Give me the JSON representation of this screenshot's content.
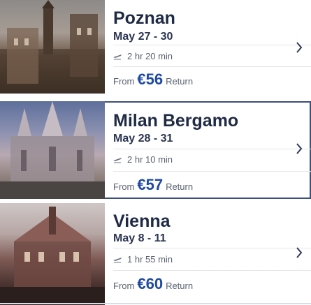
{
  "destinations": [
    {
      "city": "Poznan",
      "dates": "May 27 - 30",
      "duration": "2 hr 20 min",
      "from_label": "From",
      "price": "€56",
      "price_suffix": "Return"
    },
    {
      "city": "Milan Bergamo",
      "dates": "May 28 - 31",
      "duration": "2 hr 10 min",
      "from_label": "From",
      "price": "€57",
      "price_suffix": "Return"
    },
    {
      "city": "Vienna",
      "dates": "May 8 - 11",
      "duration": "1 hr 55 min",
      "from_label": "From",
      "price": "€60",
      "price_suffix": "Return"
    }
  ],
  "icons": {
    "flight": "plane-icon",
    "chevron": "chevron-right-icon"
  },
  "colors": {
    "title": "#1f2a44",
    "price": "#1f4aa3",
    "selected_border": "#3d4f7d"
  }
}
